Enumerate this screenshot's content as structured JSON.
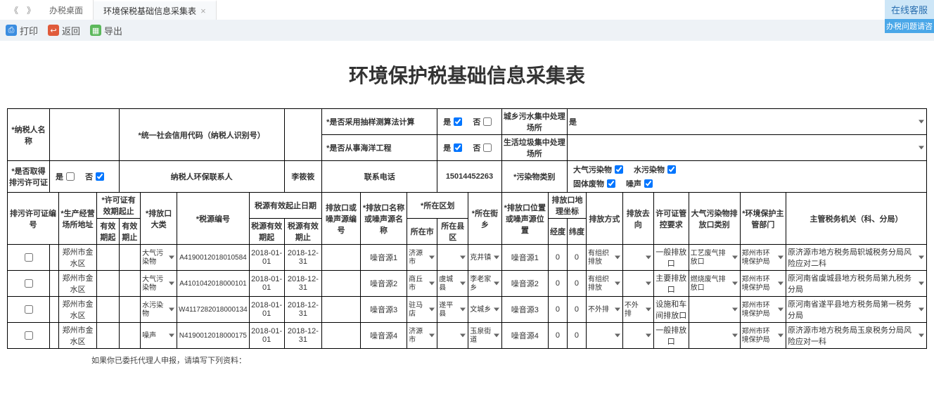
{
  "tabs": {
    "nav_left": "《",
    "nav_right": "》",
    "items": [
      {
        "label": "办税桌面"
      },
      {
        "label": "环境保税基础信息采集表",
        "close": "×"
      }
    ]
  },
  "toolbar": {
    "print": "打印",
    "back": "返回",
    "export": "导出"
  },
  "online": {
    "top": "在线客服",
    "bottom": "办税问题请咨"
  },
  "title": "环境保护税基础信息采集表",
  "form": {
    "taxpayer_name": "*纳税人名称",
    "usci": "*统一社会信用代码（纳税人识别号）",
    "use_sampling": "*是否采用抽样测算法计算",
    "ocean_eng": "*是否从事海洋工程",
    "yes": "是",
    "no": "否",
    "sewage_plant": "城乡污水集中处理场所",
    "sewage_plant_val": "是",
    "waste_plant": "生活垃圾集中处理场所",
    "has_permit": "*是否取得排污许可证",
    "env_contact": "纳税人环保联系人",
    "contact_val": "李筱筱",
    "phone": "联系电话",
    "phone_val": "15014452263",
    "pollutant_type": "*污染物类别",
    "p_air": "大气污染物",
    "p_water": "水污染物",
    "p_solid": "固体废物",
    "p_noise": "噪声"
  },
  "cols": {
    "permit_no": "排污许可证编号",
    "biz_addr": "*生产经营场所地址",
    "permit_period": "*许可证有效期起止",
    "eff_from": "有效期起",
    "eff_to": "有效期止",
    "outlet_cat": "*排放口大类",
    "tax_src_no": "*税源编号",
    "src_period": "税源有效起止日期",
    "src_from": "税源有效期起",
    "src_to": "税源有效期止",
    "outlet_no": "排放口或噪声源编号",
    "outlet_name": "*排放口名称或噪声源名称",
    "district": "*所在区划",
    "city": "所在市",
    "county": "所在县区",
    "town": "*所在街乡",
    "outlet_pos": "*排放口位置或噪声源位置",
    "coord": "排放口地理坐标",
    "lng": "经度",
    "lat": "纬度",
    "emit_mode": "排放方式",
    "emit_dir": "排放去向",
    "permit_req": "许可证管控要求",
    "air_outlet_type": "大气污染物排放口类别",
    "env_dept": "*环境保护主管部门",
    "tax_org": "主管税务机关（科、分局）"
  },
  "rows": [
    {
      "addr": "郑州市金水区",
      "cat": "大气污染物",
      "srcno": "A4190012018010584",
      "from": "2018-01-01",
      "to": "2018-12-31",
      "oname": "噪音源1",
      "city": "济源市",
      "county": "",
      "town": "克井镇",
      "pos": "噪音源1",
      "lng": "0",
      "lat": "0",
      "mode": "有组织排放",
      "dir": "",
      "req": "一般排放口",
      "atype": "工艺废气排放口",
      "dept": "郑州市环境保护局",
      "org": "原济源市地方税务局轵城税务分局风险应对二科"
    },
    {
      "addr": "郑州市金水区",
      "cat": "大气污染物",
      "srcno": "A4101042018000101",
      "from": "2018-01-01",
      "to": "2018-12-31",
      "oname": "噪音源2",
      "city": "商丘市",
      "county": "虞城县",
      "town": "李老家乡",
      "pos": "噪音源2",
      "lng": "0",
      "lat": "0",
      "mode": "有组织排放",
      "dir": "",
      "req": "主要排放口",
      "atype": "燃烧废气排放口",
      "dept": "郑州市环境保护局",
      "org": "原河南省虞城县地方税务局第九税务分局"
    },
    {
      "addr": "郑州市金水区",
      "cat": "水污染物",
      "srcno": "W4117282018000134",
      "from": "2018-01-01",
      "to": "2018-12-31",
      "oname": "噪音源3",
      "city": "驻马店",
      "county": "遂平县",
      "town": "文城乡",
      "pos": "噪音源3",
      "lng": "0",
      "lat": "0",
      "mode": "不外排",
      "dir": "不外排",
      "req": "设施和车间排放口",
      "atype": "",
      "dept": "郑州市环境保护局",
      "org": "原河南省遂平县地方税务局第一税务分局"
    },
    {
      "addr": "郑州市金水区",
      "cat": "噪声",
      "srcno": "N4190012018000175",
      "from": "2018-01-01",
      "to": "2018-12-31",
      "oname": "噪音源4",
      "city": "济源市",
      "county": "",
      "town": "玉泉街道",
      "pos": "噪音源4",
      "lng": "0",
      "lat": "0",
      "mode": "",
      "dir": "",
      "req": "一般排放口",
      "atype": "",
      "dept": "郑州市环境保护局",
      "org": "原济源市地方税务局玉泉税务分局风险应对一科"
    }
  ],
  "note": "如果你已委托代理人申报，请填写下列资料："
}
